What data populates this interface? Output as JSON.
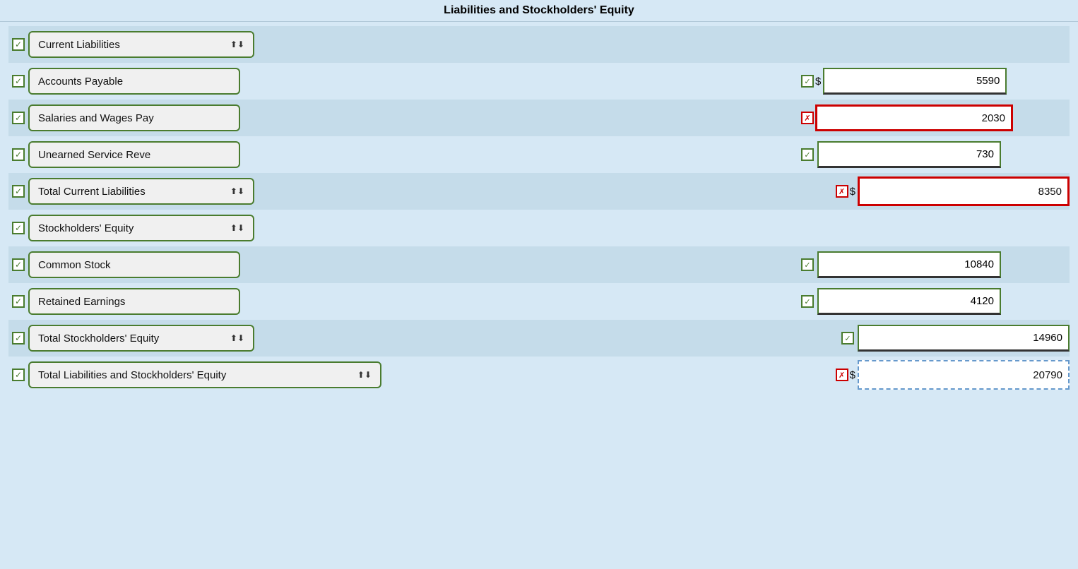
{
  "page": {
    "title": "Liabilities and Stockholders' Equity",
    "sections": [
      {
        "id": "current-liabilities-header",
        "type": "section-header",
        "label": "Current Liabilities",
        "checked": true,
        "shaded": true
      },
      {
        "id": "accounts-payable",
        "type": "line-item",
        "label": "Accounts Payable",
        "checked": true,
        "mid_checked": true,
        "mid_error": false,
        "mid_value": "5590",
        "has_dollar": true,
        "shaded": false
      },
      {
        "id": "salaries-wages",
        "type": "line-item",
        "label": "Salaries and Wages Pay",
        "checked": true,
        "mid_checked": false,
        "mid_error": true,
        "mid_value": "2030",
        "has_dollar": false,
        "shaded": true
      },
      {
        "id": "unearned-service",
        "type": "line-item",
        "label": "Unearned Service Reve",
        "checked": true,
        "mid_checked": true,
        "mid_error": false,
        "mid_value": "730",
        "has_dollar": false,
        "shaded": false
      },
      {
        "id": "total-current-liabilities",
        "type": "total-row",
        "label": "Total Current Liabilities",
        "checked": true,
        "right_error": true,
        "right_value": "8350",
        "has_dollar": true,
        "shaded": true
      },
      {
        "id": "stockholders-equity-header",
        "type": "section-header",
        "label": "Stockholders' Equity",
        "checked": true,
        "shaded": false
      },
      {
        "id": "common-stock",
        "type": "line-item",
        "label": "Common Stock",
        "checked": true,
        "mid_checked": true,
        "mid_error": false,
        "mid_value": "10840",
        "has_dollar": false,
        "shaded": true
      },
      {
        "id": "retained-earnings",
        "type": "line-item",
        "label": "Retained Earnings",
        "checked": true,
        "mid_checked": true,
        "mid_error": false,
        "mid_value": "4120",
        "has_dollar": false,
        "shaded": false
      },
      {
        "id": "total-stockholders-equity",
        "type": "total-row",
        "label": "Total Stockholders' Equity",
        "checked": true,
        "right_error": false,
        "right_checked": true,
        "right_value": "14960",
        "has_dollar": false,
        "shaded": true
      },
      {
        "id": "total-liabilities-stockholders",
        "type": "grand-total",
        "label": "Total Liabilities and Stockholders' Equity",
        "checked": true,
        "right_error": false,
        "right_x": true,
        "right_value": "20790",
        "has_dollar": true,
        "shaded": false
      }
    ]
  }
}
